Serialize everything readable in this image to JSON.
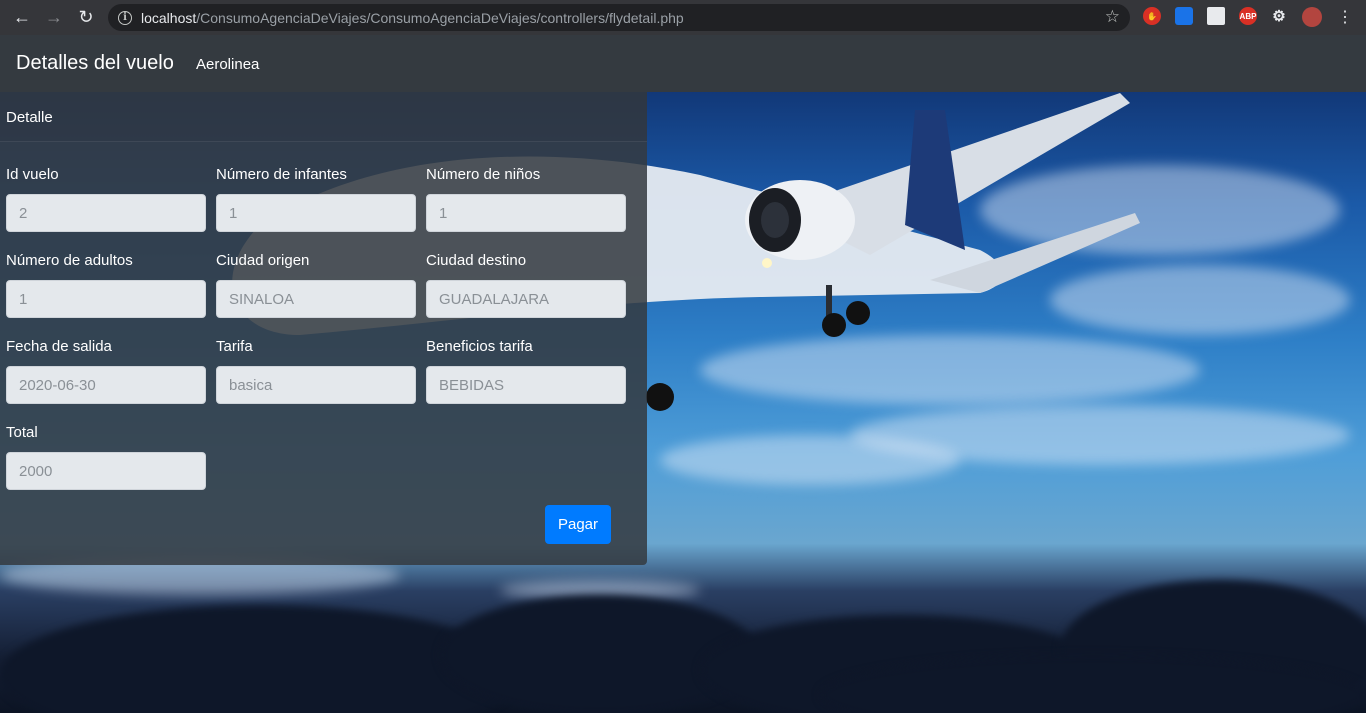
{
  "browser": {
    "url_host": "localhost",
    "url_path": "/ConsumoAgenciaDeViajes/ConsumoAgenciaDeViajes/controllers/flydetail.php",
    "extension_abp_label": "ABP"
  },
  "navbar": {
    "brand": "Detalles del vuelo",
    "link": "Aerolinea"
  },
  "card": {
    "header": "Detalle",
    "fields": [
      {
        "label": "Id vuelo",
        "value": "2"
      },
      {
        "label": "Número de infantes",
        "value": "1"
      },
      {
        "label": "Número de niños",
        "value": "1"
      },
      {
        "label": "Número de adultos",
        "value": "1"
      },
      {
        "label": "Ciudad origen",
        "value": "SINALOA"
      },
      {
        "label": "Ciudad destino",
        "value": "GUADALAJARA"
      },
      {
        "label": "Fecha de salida",
        "value": "2020-06-30"
      },
      {
        "label": "Tarifa",
        "value": "basica"
      },
      {
        "label": "Beneficios tarifa",
        "value": "BEBIDAS"
      },
      {
        "label": "Total",
        "value": "2000"
      }
    ],
    "pay_button": "Pagar"
  },
  "colors": {
    "navbar_bg": "#343a40",
    "primary": "#007bff"
  }
}
